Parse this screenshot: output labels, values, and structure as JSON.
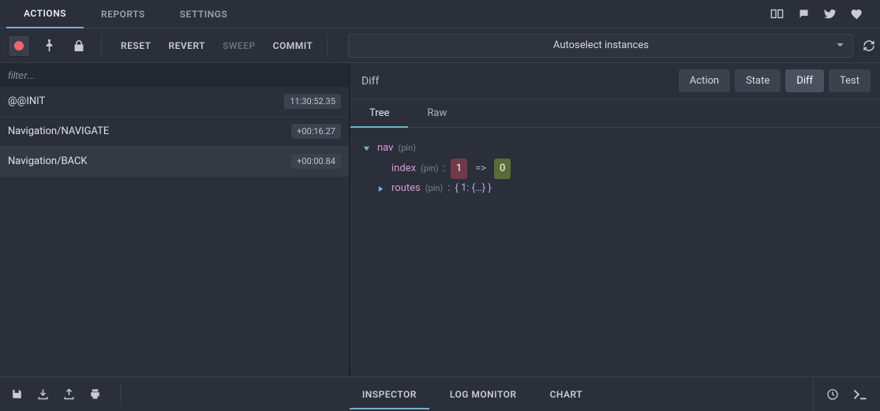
{
  "top_tabs": {
    "actions": "ACTIONS",
    "reports": "REPORTS",
    "settings": "SETTINGS"
  },
  "toolbar": {
    "reset": "RESET",
    "revert": "REVERT",
    "sweep": "SWEEP",
    "commit": "COMMIT",
    "instance_label": "Autoselect instances"
  },
  "filter": {
    "placeholder": "filter..."
  },
  "actions": [
    {
      "name": "@@INIT",
      "time": "11:30:52.35"
    },
    {
      "name": "Navigation/NAVIGATE",
      "time": "+00:16.27"
    },
    {
      "name": "Navigation/BACK",
      "time": "+00:00.84"
    }
  ],
  "panel": {
    "title": "Diff",
    "tabs": {
      "action": "Action",
      "state": "State",
      "diff": "Diff",
      "test": "Test"
    },
    "subtabs": {
      "tree": "Tree",
      "raw": "Raw"
    }
  },
  "tree": {
    "root_key": "nav",
    "pin": "(pin)",
    "index_key": "index",
    "index_old": "1",
    "index_arrow": "=>",
    "index_new": "0",
    "routes_key": "routes",
    "routes_summary": "{ 1: {…} }"
  },
  "bottom": {
    "inspector": "INSPECTOR",
    "log_monitor": "LOG MONITOR",
    "chart": "CHART"
  }
}
